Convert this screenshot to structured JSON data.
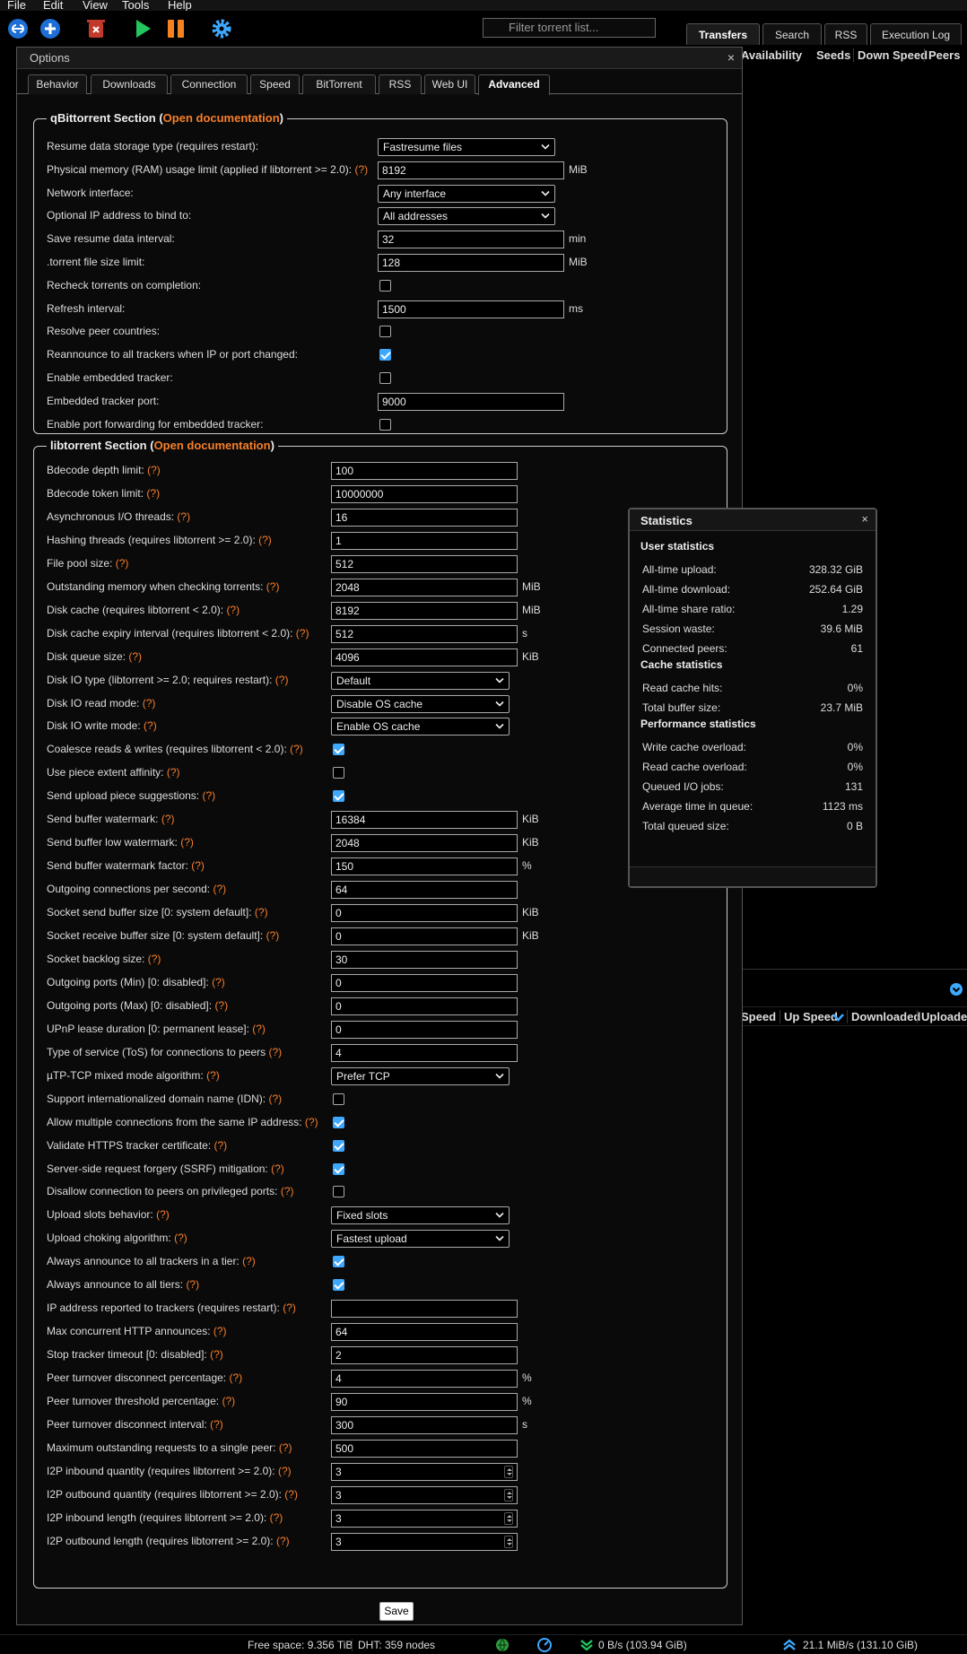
{
  "menu": [
    "File",
    "Edit",
    "View",
    "Tools",
    "Help"
  ],
  "toolbar": {
    "filter_placeholder": "Filter torrent list...",
    "icons": [
      "link-icon",
      "add-icon",
      "delete-icon",
      "resume-icon",
      "pause-icon",
      "settings-icon"
    ]
  },
  "main_tabs": [
    "Transfers",
    "Search",
    "RSS",
    "Execution Log"
  ],
  "list_headers": [
    "Availability",
    "Seeds",
    "Down Speed",
    "Peers"
  ],
  "bottom_headers": [
    "Speed",
    "Up Speed",
    "Downloaded",
    "Uploaded"
  ],
  "options": {
    "title": "Options",
    "close": "×",
    "tabs": [
      "Behavior",
      "Downloads",
      "Connection",
      "Speed",
      "BitTorrent",
      "RSS",
      "Web UI",
      "Advanced"
    ],
    "active_tab": "Advanced",
    "qbt_section": {
      "title": "qBittorrent Section (",
      "link": "Open documentation",
      "close_paren": ")",
      "rows": [
        {
          "label": "Resume data storage type (requires restart):",
          "type": "select",
          "value": "Fastresume files"
        },
        {
          "label": "Physical memory (RAM) usage limit (applied if libtorrent >= 2.0):",
          "q": "(?)",
          "type": "input",
          "value": "8192",
          "unit": "MiB"
        },
        {
          "label": "Network interface:",
          "type": "select",
          "value": "Any interface"
        },
        {
          "label": "Optional IP address to bind to:",
          "type": "select",
          "value": "All addresses"
        },
        {
          "label": "Save resume data interval:",
          "type": "input",
          "value": "32",
          "unit": "min"
        },
        {
          "label": ".torrent file size limit:",
          "type": "input",
          "value": "128",
          "unit": "MiB"
        },
        {
          "label": "Recheck torrents on completion:",
          "type": "checkbox",
          "checked": false
        },
        {
          "label": "Refresh interval:",
          "type": "input",
          "value": "1500",
          "unit": "ms"
        },
        {
          "label": "Resolve peer countries:",
          "type": "checkbox",
          "checked": false
        },
        {
          "label": "Reannounce to all trackers when IP or port changed:",
          "type": "checkbox",
          "checked": true
        },
        {
          "label": "Enable embedded tracker:",
          "type": "checkbox",
          "checked": false
        },
        {
          "label": "Embedded tracker port:",
          "type": "input",
          "value": "9000"
        },
        {
          "label": "Enable port forwarding for embedded tracker:",
          "type": "checkbox",
          "checked": false
        }
      ]
    },
    "lt_section": {
      "title": "libtorrent Section (",
      "link": "Open documentation",
      "close_paren": ")",
      "rows": [
        {
          "label": "Bdecode depth limit:",
          "q": "(?)",
          "type": "input",
          "value": "100"
        },
        {
          "label": "Bdecode token limit:",
          "q": "(?)",
          "type": "input",
          "value": "10000000"
        },
        {
          "label": "Asynchronous I/O threads:",
          "q": "(?)",
          "type": "input",
          "value": "16"
        },
        {
          "label": "Hashing threads (requires libtorrent >= 2.0):",
          "q": "(?)",
          "type": "input",
          "value": "1"
        },
        {
          "label": "File pool size:",
          "q": "(?)",
          "type": "input",
          "value": "512"
        },
        {
          "label": "Outstanding memory when checking torrents:",
          "q": "(?)",
          "type": "input",
          "value": "2048",
          "unit": "MiB"
        },
        {
          "label": "Disk cache (requires libtorrent < 2.0):",
          "q": "(?)",
          "type": "input",
          "value": "8192",
          "unit": "MiB"
        },
        {
          "label": "Disk cache expiry interval (requires libtorrent < 2.0):",
          "q": "(?)",
          "type": "input",
          "value": "512",
          "unit": "s"
        },
        {
          "label": "Disk queue size:",
          "q": "(?)",
          "type": "input",
          "value": "4096",
          "unit": "KiB"
        },
        {
          "label": "Disk IO type (libtorrent >= 2.0; requires restart):",
          "q": "(?)",
          "type": "select",
          "value": "Default"
        },
        {
          "label": "Disk IO read mode:",
          "q": "(?)",
          "type": "select",
          "value": "Disable OS cache"
        },
        {
          "label": "Disk IO write mode:",
          "q": "(?)",
          "type": "select",
          "value": "Enable OS cache"
        },
        {
          "label": "Coalesce reads & writes (requires libtorrent < 2.0):",
          "q": "(?)",
          "type": "checkbox",
          "checked": true
        },
        {
          "label": "Use piece extent affinity:",
          "q": "(?)",
          "type": "checkbox",
          "checked": false
        },
        {
          "label": "Send upload piece suggestions:",
          "q": "(?)",
          "type": "checkbox",
          "checked": true
        },
        {
          "label": "Send buffer watermark:",
          "q": "(?)",
          "type": "input",
          "value": "16384",
          "unit": "KiB"
        },
        {
          "label": "Send buffer low watermark:",
          "q": "(?)",
          "type": "input",
          "value": "2048",
          "unit": "KiB"
        },
        {
          "label": "Send buffer watermark factor:",
          "q": "(?)",
          "type": "input",
          "value": "150",
          "unit": "%"
        },
        {
          "label": "Outgoing connections per second:",
          "q": "(?)",
          "type": "input",
          "value": "64"
        },
        {
          "label": "Socket send buffer size [0: system default]:",
          "q": "(?)",
          "type": "input",
          "value": "0",
          "unit": "KiB"
        },
        {
          "label": "Socket receive buffer size [0: system default]:",
          "q": "(?)",
          "type": "input",
          "value": "0",
          "unit": "KiB"
        },
        {
          "label": "Socket backlog size:",
          "q": "(?)",
          "type": "input",
          "value": "30"
        },
        {
          "label": "Outgoing ports (Min) [0: disabled]:",
          "q": "(?)",
          "type": "input",
          "value": "0"
        },
        {
          "label": "Outgoing ports (Max) [0: disabled]:",
          "q": "(?)",
          "type": "input",
          "value": "0"
        },
        {
          "label": "UPnP lease duration [0: permanent lease]:",
          "q": "(?)",
          "type": "input",
          "value": "0"
        },
        {
          "label": "Type of service (ToS) for connections to peers",
          "q": "(?)",
          "type": "input",
          "value": "4"
        },
        {
          "label": "µTP-TCP mixed mode algorithm:",
          "q": "(?)",
          "type": "select",
          "value": "Prefer TCP"
        },
        {
          "label": "Support internationalized domain name (IDN):",
          "q": "(?)",
          "type": "checkbox",
          "checked": false
        },
        {
          "label": "Allow multiple connections from the same IP address:",
          "q": "(?)",
          "type": "checkbox",
          "checked": true
        },
        {
          "label": "Validate HTTPS tracker certificate:",
          "q": "(?)",
          "type": "checkbox",
          "checked": true
        },
        {
          "label": "Server-side request forgery (SSRF) mitigation:",
          "q": "(?)",
          "type": "checkbox",
          "checked": true
        },
        {
          "label": "Disallow connection to peers on privileged ports:",
          "q": "(?)",
          "type": "checkbox",
          "checked": false
        },
        {
          "label": "Upload slots behavior:",
          "q": "(?)",
          "type": "select",
          "value": "Fixed slots"
        },
        {
          "label": "Upload choking algorithm:",
          "q": "(?)",
          "type": "select",
          "value": "Fastest upload"
        },
        {
          "label": "Always announce to all trackers in a tier:",
          "q": "(?)",
          "type": "checkbox",
          "checked": true
        },
        {
          "label": "Always announce to all tiers:",
          "q": "(?)",
          "type": "checkbox",
          "checked": true
        },
        {
          "label": "IP address reported to trackers (requires restart):",
          "q": "(?)",
          "type": "input",
          "value": ""
        },
        {
          "label": "Max concurrent HTTP announces:",
          "q": "(?)",
          "type": "input",
          "value": "64"
        },
        {
          "label": "Stop tracker timeout [0: disabled]:",
          "q": "(?)",
          "type": "input",
          "value": "2"
        },
        {
          "label": "Peer turnover disconnect percentage:",
          "q": "(?)",
          "type": "input",
          "value": "4",
          "unit": "%"
        },
        {
          "label": "Peer turnover threshold percentage:",
          "q": "(?)",
          "type": "input",
          "value": "90",
          "unit": "%"
        },
        {
          "label": "Peer turnover disconnect interval:",
          "q": "(?)",
          "type": "input",
          "value": "300",
          "unit": "s"
        },
        {
          "label": "Maximum outstanding requests to a single peer:",
          "q": "(?)",
          "type": "input",
          "value": "500"
        },
        {
          "label": "I2P inbound quantity (requires libtorrent >= 2.0):",
          "q": "(?)",
          "type": "spin",
          "value": "3"
        },
        {
          "label": "I2P outbound quantity (requires libtorrent >= 2.0):",
          "q": "(?)",
          "type": "spin",
          "value": "3"
        },
        {
          "label": "I2P inbound length (requires libtorrent >= 2.0):",
          "q": "(?)",
          "type": "spin",
          "value": "3"
        },
        {
          "label": "I2P outbound length (requires libtorrent >= 2.0):",
          "q": "(?)",
          "type": "spin",
          "value": "3"
        }
      ]
    },
    "save_label": "Save"
  },
  "statistics": {
    "title": "Statistics",
    "close": "×",
    "sections": [
      {
        "heading": "User statistics",
        "rows": [
          {
            "label": "All-time upload:",
            "value": "328.32 GiB"
          },
          {
            "label": "All-time download:",
            "value": "252.64 GiB"
          },
          {
            "label": "All-time share ratio:",
            "value": "1.29"
          },
          {
            "label": "Session waste:",
            "value": "39.6 MiB"
          },
          {
            "label": "Connected peers:",
            "value": "61"
          }
        ]
      },
      {
        "heading": "Cache statistics",
        "rows": [
          {
            "label": "Read cache hits:",
            "value": "0%"
          },
          {
            "label": "Total buffer size:",
            "value": "23.7 MiB"
          }
        ]
      },
      {
        "heading": "Performance statistics",
        "rows": [
          {
            "label": "Write cache overload:",
            "value": "0%"
          },
          {
            "label": "Read cache overload:",
            "value": "0%"
          },
          {
            "label": "Queued I/O jobs:",
            "value": "131"
          },
          {
            "label": "Average time in queue:",
            "value": "1123 ms"
          },
          {
            "label": "Total queued size:",
            "value": "0 B"
          }
        ]
      }
    ]
  },
  "statusbar": {
    "free_space": "Free space: 9.356 TiB",
    "dht": "DHT: 359 nodes",
    "down": "0 B/s (103.94 GiB)",
    "up": "21.1 MiB/s (131.10 GiB)"
  },
  "colors": {
    "accent": "#3ea8ff",
    "link": "#f77f2a",
    "resume": "#22c55e",
    "pause": "#f5821f",
    "delete": "#c0392b"
  }
}
